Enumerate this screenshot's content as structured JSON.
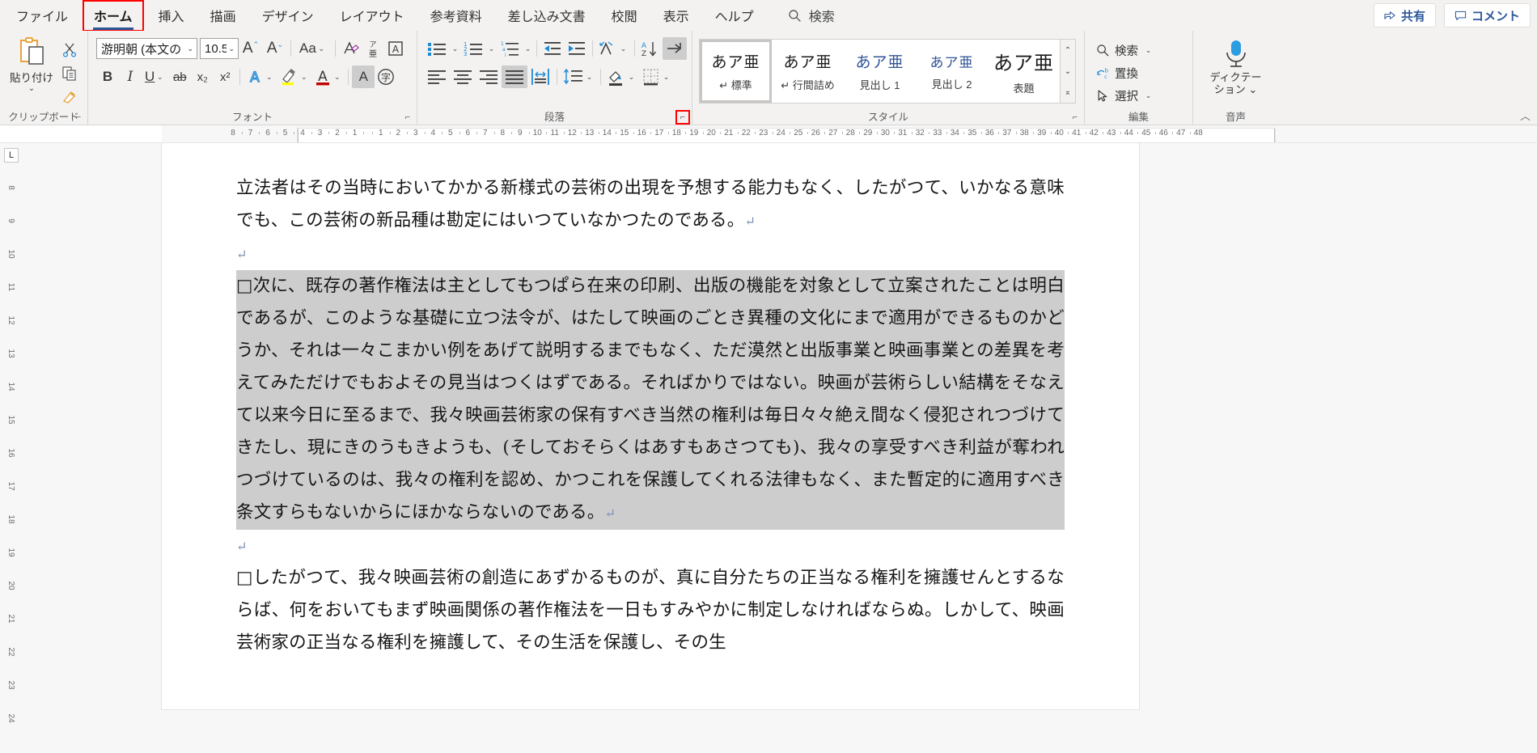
{
  "app": {
    "ribbon_tabs": [
      {
        "label": "ファイル",
        "active": false
      },
      {
        "label": "ホーム",
        "active": true,
        "highlight": "red-box"
      },
      {
        "label": "挿入",
        "active": false
      },
      {
        "label": "描画",
        "active": false
      },
      {
        "label": "デザイン",
        "active": false
      },
      {
        "label": "レイアウト",
        "active": false
      },
      {
        "label": "参考資料",
        "active": false
      },
      {
        "label": "差し込み文書",
        "active": false
      },
      {
        "label": "校閲",
        "active": false
      },
      {
        "label": "表示",
        "active": false
      },
      {
        "label": "ヘルプ",
        "active": false
      }
    ],
    "search": {
      "icon": "search-icon",
      "label": "検索"
    },
    "share_button": {
      "icon": "share-icon",
      "label": "共有"
    },
    "comments_button": {
      "icon": "comment-icon",
      "label": "コメント"
    },
    "collapse_ribbon": "︿"
  },
  "ribbon": {
    "clipboard": {
      "group_label": "クリップボード",
      "paste": {
        "label": "貼り付け",
        "icon": "paste-icon",
        "caret": "⌄"
      },
      "cut": {
        "icon": "scissors-icon"
      },
      "copy": {
        "icon": "copy-icon"
      },
      "format_painter": {
        "icon": "format-painter-icon"
      },
      "dialog_launcher": "⌐"
    },
    "font": {
      "group_label": "フォント",
      "font_name": {
        "value": "游明朝 (本文のフォ",
        "caret": "⌄"
      },
      "font_size": {
        "value": "10.5",
        "caret": "⌄"
      },
      "grow_font": {
        "icon": "grow-font-icon",
        "glyph": "A"
      },
      "shrink_font": {
        "icon": "shrink-font-icon",
        "glyph": "A"
      },
      "change_case": {
        "icon": "change-case-icon",
        "glyph": "Aa",
        "caret": "⌄"
      },
      "clear_formatting": {
        "icon": "clear-formatting-icon",
        "glyph": "A"
      },
      "phonetic_guide": {
        "icon": "phonetic-guide-icon",
        "glyph": "ア亜"
      },
      "character_border": {
        "icon": "character-border-icon",
        "glyph": "A"
      },
      "bold": {
        "icon": "bold-icon",
        "glyph": "B"
      },
      "italic": {
        "icon": "italic-icon",
        "glyph": "I"
      },
      "underline": {
        "icon": "underline-icon",
        "glyph": "U",
        "caret": "⌄"
      },
      "strikethrough": {
        "icon": "strikethrough-icon",
        "glyph": "ab"
      },
      "subscript": {
        "icon": "subscript-icon",
        "glyph": "x₂"
      },
      "superscript": {
        "icon": "superscript-icon",
        "glyph": "x²"
      },
      "text_effects": {
        "icon": "text-effects-icon",
        "glyph": "A",
        "caret": "⌄"
      },
      "text_highlight": {
        "icon": "highlight-icon",
        "caret": "⌄",
        "color": "#ffff00"
      },
      "font_color": {
        "icon": "font-color-icon",
        "glyph": "A",
        "caret": "⌄",
        "color": "#c00000"
      },
      "character_shading": {
        "icon": "character-shading-icon",
        "glyph": "A"
      },
      "enclose_characters": {
        "icon": "enclose-characters-icon",
        "glyph": "字"
      },
      "dialog_launcher": "⌐"
    },
    "paragraph": {
      "group_label": "段落",
      "bullets": {
        "icon": "bullet-list-icon",
        "caret": "⌄"
      },
      "numbering": {
        "icon": "numbered-list-icon",
        "caret": "⌄"
      },
      "multilevel_list": {
        "icon": "multilevel-list-icon",
        "caret": "⌄"
      },
      "decrease_indent": {
        "icon": "decrease-indent-icon"
      },
      "increase_indent": {
        "icon": "increase-indent-icon"
      },
      "phonetic_sort_helper": {
        "icon": "text-direction-icon",
        "caret": "⌄"
      },
      "sort": {
        "icon": "sort-az-icon"
      },
      "show_marks": {
        "icon": "show-paragraph-marks-icon",
        "selected": true
      },
      "align_left": {
        "icon": "align-left-icon"
      },
      "align_center": {
        "icon": "align-center-icon"
      },
      "align_right": {
        "icon": "align-right-icon"
      },
      "justify": {
        "icon": "justify-icon",
        "selected": true
      },
      "distribute": {
        "icon": "distribute-icon"
      },
      "line_spacing": {
        "icon": "line-spacing-icon",
        "caret": "⌄"
      },
      "shading": {
        "icon": "shading-icon",
        "caret": "⌄"
      },
      "borders": {
        "icon": "borders-icon",
        "caret": "⌄"
      },
      "dialog_launcher": "⌐",
      "dialog_launcher_highlight": "red-box"
    },
    "styles": {
      "group_label": "スタイル",
      "sample_text": "あア亜",
      "items": [
        {
          "name": "標準",
          "mark": "↵",
          "selected": true
        },
        {
          "name": "行間詰め",
          "mark": "↵",
          "selected": false
        },
        {
          "name": "見出し 1",
          "mark": "",
          "selected": false
        },
        {
          "name": "見出し 2",
          "mark": "",
          "selected": false
        },
        {
          "name": "表題",
          "mark": "",
          "selected": false
        }
      ],
      "scroll_up": "⌃",
      "scroll_down": "⌄",
      "scroll_more": "⌅",
      "dialog_launcher": "⌐"
    },
    "editing": {
      "group_label": "編集",
      "find": {
        "label": "検索",
        "icon": "search-icon",
        "caret": "⌄"
      },
      "replace": {
        "label": "置換",
        "icon": "replace-icon"
      },
      "select": {
        "label": "選択",
        "icon": "select-cursor-icon",
        "caret": "⌄"
      }
    },
    "voice": {
      "group_label": "音声",
      "dictate": {
        "label_line1": "ディクテー",
        "label_line2": "ション",
        "icon": "microphone-icon",
        "caret": "⌄"
      }
    }
  },
  "ruler": {
    "horizontal_ticks": [
      "8",
      "7",
      "6",
      "5",
      "4",
      "3",
      "2",
      "1",
      "1",
      "2",
      "3",
      "4",
      "5",
      "6",
      "7",
      "8",
      "9",
      "10",
      "11",
      "12",
      "13",
      "14",
      "15",
      "16",
      "17",
      "18",
      "19",
      "20",
      "21",
      "22",
      "23",
      "24",
      "25",
      "26",
      "27",
      "28",
      "29",
      "30",
      "31",
      "32",
      "33",
      "34",
      "35",
      "36",
      "37",
      "38",
      "39",
      "40",
      "41",
      "42",
      "43",
      "44",
      "45",
      "46",
      "47",
      "48"
    ],
    "vertical_ticks": [
      "8",
      "9",
      "10",
      "11",
      "12",
      "13",
      "14",
      "15",
      "16",
      "17",
      "18",
      "19",
      "20",
      "21",
      "22",
      "23",
      "24"
    ],
    "tab_selector": "L"
  },
  "document": {
    "paragraphs": [
      {
        "id": "p1",
        "selected": false,
        "text": "立法者はその当時においてかかる新様式の芸術の出現を予想する能力もなく、したがつて、いかなる意味でも、この芸術の新品種は勘定にはいつていなかつたのである。",
        "mark": "↵"
      },
      {
        "id": "p2",
        "selected": false,
        "text": "",
        "mark": "↵"
      },
      {
        "id": "p3",
        "selected": true,
        "text": "□次に、既存の著作権法は主としてもつぱら在来の印刷、出版の機能を対象として立案されたことは明白であるが、このような基礎に立つ法令が、はたして映画のごとき異種の文化にまで適用ができるものかどうか、それは一々こまかい例をあげて説明するまでもなく、ただ漠然と出版事業と映画事業との差異を考えてみただけでもおよその見当はつくはずである。そればかりではない。映画が芸術らしい結構をそなえて以来今日に至るまで、我々映画芸術家の保有すべき当然の権利は毎日々々絶え間なく侵犯されつづけてきたし、現にきのうもきようも、(そしておそらくはあすもあさつても)、我々の享受すべき利益が奪われつづけているのは、我々の権利を認め、かつこれを保護してくれる法律もなく、また暫定的に適用すべき条文すらもないからにほかならないのである。",
        "mark": "↵"
      },
      {
        "id": "p4",
        "selected": false,
        "text": "",
        "mark": "↵"
      },
      {
        "id": "p5",
        "selected": false,
        "text": "□したがつて、我々映画芸術の創造にあずかるものが、真に自分たちの正当なる権利を擁護せんとするならば、何をおいてもまず映画関係の著作権法を一日もすみやかに制定しなければならぬ。しかして、映画芸術家の正当なる権利を擁護して、その生活を保護し、その生",
        "mark": ""
      }
    ]
  }
}
